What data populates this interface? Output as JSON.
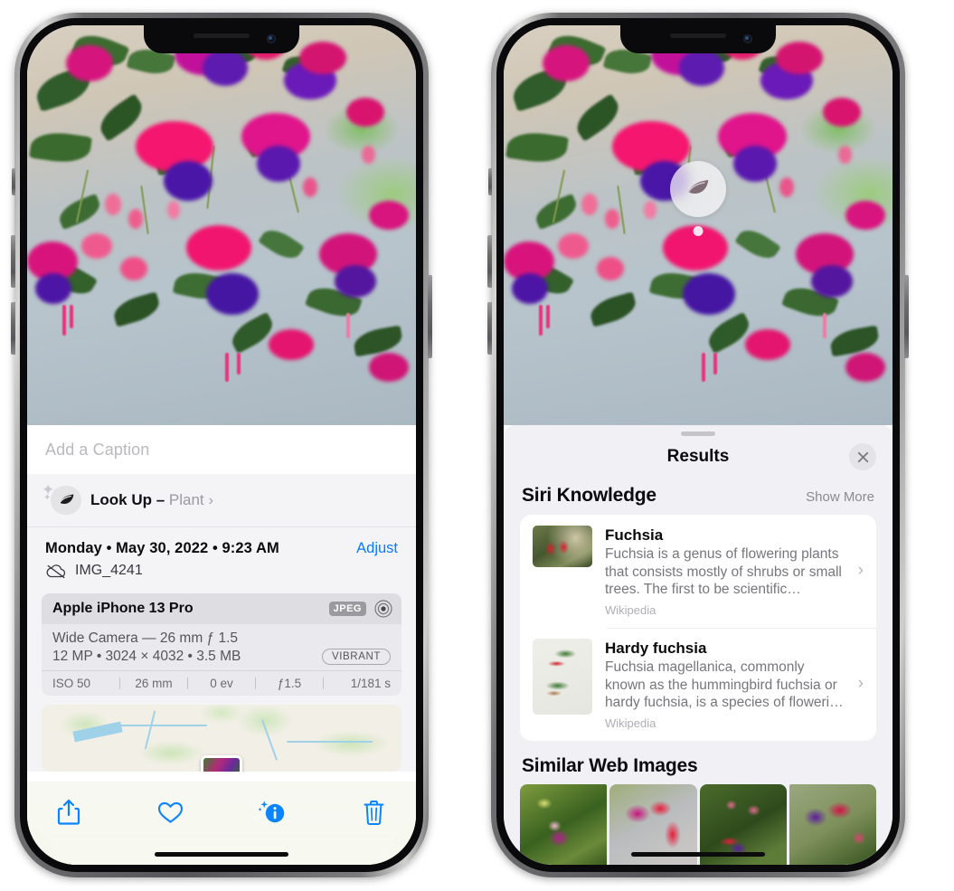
{
  "left_phone": {
    "name": "iPhone photo detail view",
    "caption_field": {
      "placeholder": "Add a Caption",
      "value": ""
    },
    "lookup_row": {
      "icon": "leaf-icon",
      "sparkle_icon": "sparkle-icon",
      "label": "Look Up",
      "dash": " – ",
      "subject": "Plant",
      "chevron": "›"
    },
    "meta": {
      "date": "Monday • May 30, 2022 • 9:23 AM",
      "adjust_label": "Adjust",
      "icloud_icon": "icloud-slash-icon",
      "filename": "IMG_4241"
    },
    "device_card": {
      "device": "Apple iPhone 13 Pro",
      "format_badge": "JPEG",
      "raw_icon": "raw-circle-icon",
      "lens_line": "Wide Camera — 26 mm ƒ 1.5",
      "specs_line": "12 MP  •  3024 × 4032  •  3.5 MB",
      "style_badge": "VIBRANT",
      "exif": [
        "ISO 50",
        "26 mm",
        "0 ev",
        "ƒ1.5",
        "1/181 s"
      ]
    },
    "map": {
      "name": "location-map-thumbnail",
      "pin": "photo-pin"
    },
    "toolbar": [
      {
        "name": "share-button",
        "icon": "share-icon"
      },
      {
        "name": "favorite-button",
        "icon": "heart-icon"
      },
      {
        "name": "info-button",
        "icon": "info-sparkle-icon"
      },
      {
        "name": "delete-button",
        "icon": "trash-icon"
      }
    ],
    "accent_color": "#0a7cff"
  },
  "right_phone": {
    "name": "Visual Look Up results view",
    "photo_badge": {
      "icon": "leaf-icon",
      "tooltip_dot": true
    },
    "sheet": {
      "grabber": true,
      "title": "Results",
      "close_icon": "close-icon"
    },
    "siri_knowledge": {
      "section_title": "Siri Knowledge",
      "action_label": "Show More",
      "items": [
        {
          "title": "Fuchsia",
          "description": "Fuchsia is a genus of flowering plants that consists mostly of shrubs or small trees. The first to be scientific…",
          "source": "Wikipedia",
          "thumb": "fuchsia-thumbnail",
          "chevron": "›"
        },
        {
          "title": "Hardy fuchsia",
          "description": "Fuchsia magellanica, commonly known as the hummingbird fuchsia or hardy fuchsia, is a species of floweri…",
          "source": "Wikipedia",
          "thumb": "hardy-fuchsia-thumbnail",
          "chevron": "›"
        }
      ]
    },
    "similar_web_images": {
      "section_title": "Similar Web Images",
      "items": [
        {
          "name": "web-image-1"
        },
        {
          "name": "web-image-2"
        },
        {
          "name": "web-image-3"
        },
        {
          "name": "web-image-4"
        }
      ]
    }
  }
}
